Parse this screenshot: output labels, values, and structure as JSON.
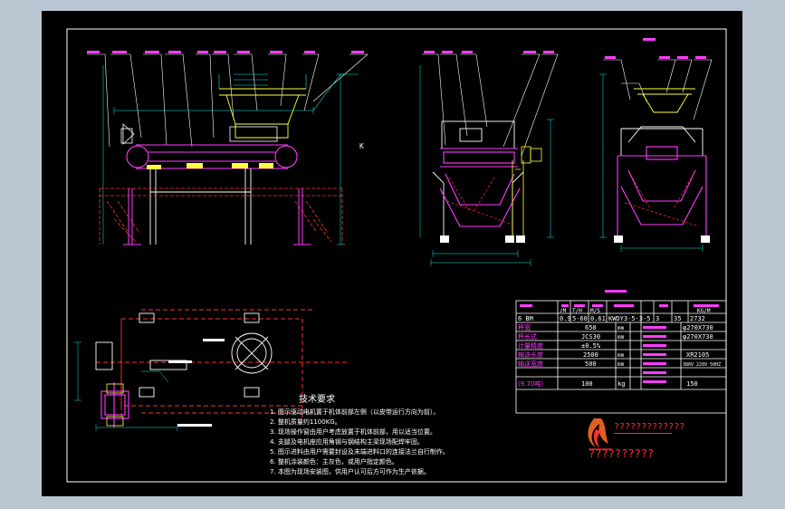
{
  "dimension_letter": "K",
  "tech": {
    "title": "技术要求",
    "notes": [
      "1.  图示驱动电机置于机体前部左侧（以皮带运行方向为前）。",
      "2.  整机质量约1100KG。",
      "3.  现场操作窗由用户考虑放置于机体前部，用以适当位置。",
      "4.  支腿及电机座应用角钢与钢结构主梁现场配焊牢固。",
      "5.  图示进料由用户需要封设及末端进料口的连接法兰自行制作。",
      "6.  整机涂装颜色：主灰色，或用户指定颜色。",
      "7.  本图为现场安装图，供用户认可后方可作为生产依据。"
    ]
  },
  "table": {
    "header_left": "6  BM",
    "header_vals": [
      "0.9",
      "5-60",
      "0.61",
      "KWDY3-5-3-5",
      "3",
      "35",
      "2732"
    ],
    "header_units": [
      "/M",
      "T/H",
      "M/S",
      "",
      "KG/M"
    ],
    "rows": [
      {
        "label": "秤宽",
        "value": "650",
        "unit": "mm",
        "right": "φ270X730"
      },
      {
        "label": "秤长式",
        "value": "JCS30",
        "unit": "mm",
        "right": "φ270X730"
      },
      {
        "label": "计量精度",
        "value": "±0.5%",
        "unit": "",
        "right": ""
      },
      {
        "label": "输送长度",
        "value": "2500",
        "unit": "mm",
        "right": "XR2105"
      },
      {
        "label": "输送宽度",
        "value": "500",
        "unit": "mm",
        "right": "380V 220V 50HZ"
      },
      {
        "label": "(9.70吨)",
        "value": "100",
        "unit": "kg",
        "right": "150"
      }
    ]
  },
  "title_block": {
    "company": "?????????????",
    "drawing": "??????????"
  },
  "colors": {
    "background": "#000000",
    "frame": "#ffffff",
    "magenta": "#ff3cff",
    "red": "#ff3030",
    "cyan": "#00f0f0",
    "yellow": "#ffff40",
    "green": "#40ff40",
    "purple": "#b060ff",
    "white": "#ffffff"
  }
}
